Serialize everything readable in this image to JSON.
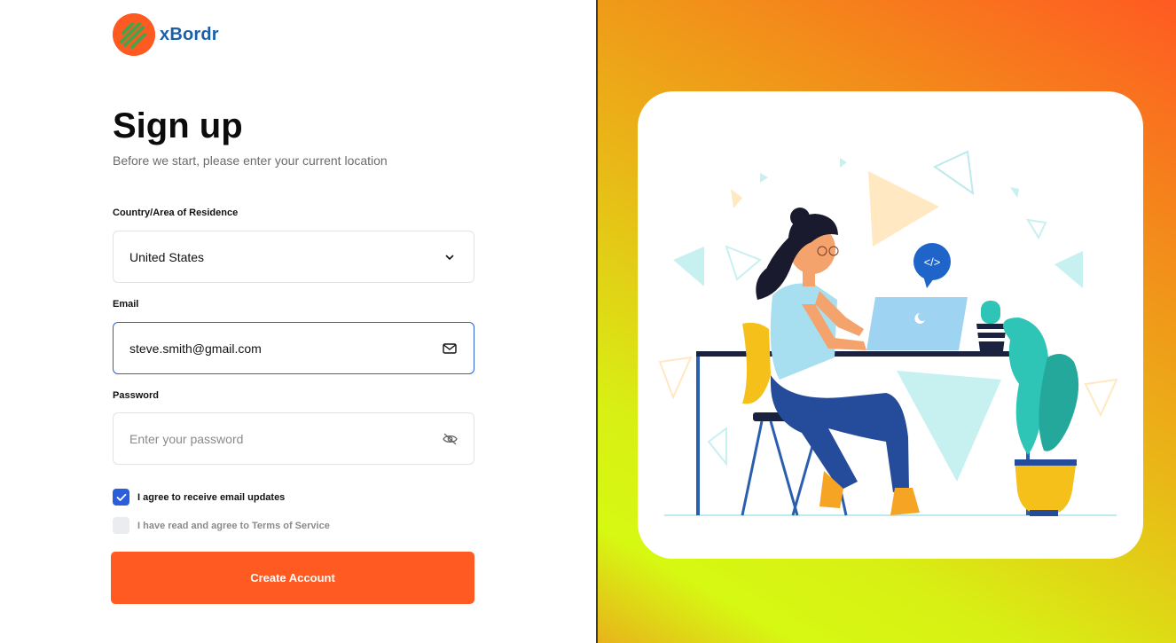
{
  "brand": {
    "name": "xBordr",
    "accent": "#ff5a22",
    "logo_text_color": "#1b5fa8"
  },
  "heading": {
    "title": "Sign up",
    "subtitle": "Before we start, please enter your current location"
  },
  "form": {
    "country": {
      "label": "Country/Area of Residence",
      "value": "United States",
      "icon": "chevron-down-icon"
    },
    "email": {
      "label": "Email",
      "value": "steve.smith@gmail.com",
      "icon": "mail-icon"
    },
    "password": {
      "label": "Password",
      "placeholder": "Enter your password",
      "value": "",
      "icon": "eye-off-icon"
    },
    "checkboxes": [
      {
        "label": "I agree to receive email updates",
        "checked": true
      },
      {
        "label": "I have read and agree to Terms of Service",
        "checked": false
      }
    ],
    "submit_label": "Create Account"
  },
  "illustration": {
    "name": "woman-coding-at-laptop",
    "code_bubble": "</>"
  },
  "colors": {
    "primary_button": "#ff5a22",
    "focus_blue": "#2b5fd9",
    "card_bg": "#ffffff"
  }
}
